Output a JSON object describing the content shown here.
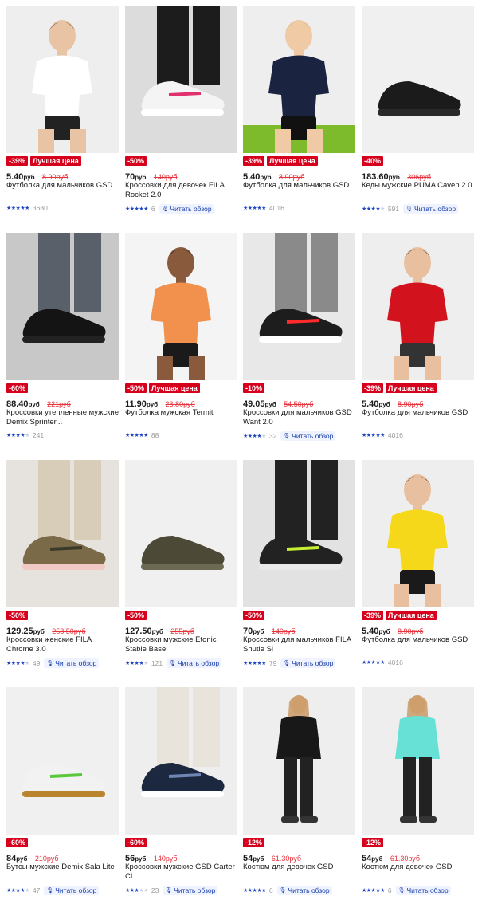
{
  "colors": {
    "discount_badge": "#d6001c",
    "old_price": "#e8323c",
    "stars": "#1f47c2",
    "review_link": "#1a3ea8"
  },
  "products": [
    {
      "discount": "-39%",
      "tag": "Лучшая цена",
      "price": "5.40",
      "currency": "руб",
      "old_price": "8.90руб",
      "name": "Футболка для мальчиков GSD",
      "rating": 5,
      "reviews": "3680",
      "review_link": ""
    },
    {
      "discount": "-50%",
      "tag": "",
      "price": "70",
      "currency": "руб",
      "old_price": "140руб",
      "name": "Кроссовки для девочек FILA Rocket 2.0",
      "rating": 5,
      "reviews": "6",
      "review_link": "Читать обзор"
    },
    {
      "discount": "-39%",
      "tag": "Лучшая цена",
      "price": "5.40",
      "currency": "руб",
      "old_price": "8.90руб",
      "name": "Футболка для мальчиков GSD",
      "rating": 5,
      "reviews": "4016",
      "review_link": ""
    },
    {
      "discount": "-40%",
      "tag": "",
      "price": "183.60",
      "currency": "руб",
      "old_price": "306руб",
      "name": "Кеды мужские PUMA Caven 2.0",
      "rating": 4,
      "reviews": "591",
      "review_link": "Читать обзор"
    },
    {
      "discount": "-60%",
      "tag": "",
      "price": "88.40",
      "currency": "руб",
      "old_price": "221руб",
      "name": "Кроссовки утепленные мужские Demix Sprinter...",
      "rating": 4,
      "reviews": "241",
      "review_link": ""
    },
    {
      "discount": "-50%",
      "tag": "Лучшая цена",
      "price": "11.90",
      "currency": "руб",
      "old_price": "23.80руб",
      "name": "Футболка мужская Termit",
      "rating": 5,
      "reviews": "88",
      "review_link": ""
    },
    {
      "discount": "-10%",
      "tag": "",
      "price": "49.05",
      "currency": "руб",
      "old_price": "54.50руб",
      "name": "Кроссовки для мальчиков GSD Want 2.0",
      "rating": 4,
      "reviews": "32",
      "review_link": "Читать обзор"
    },
    {
      "discount": "-39%",
      "tag": "Лучшая цена",
      "price": "5.40",
      "currency": "руб",
      "old_price": "8.90руб",
      "name": "Футболка для мальчиков GSD",
      "rating": 5,
      "reviews": "4016",
      "review_link": ""
    },
    {
      "discount": "-50%",
      "tag": "",
      "price": "129.25",
      "currency": "руб",
      "old_price": "258.50руб",
      "name": "Кроссовки женские FILA Chrome 3.0",
      "rating": 4,
      "reviews": "49",
      "review_link": "Читать обзор"
    },
    {
      "discount": "-50%",
      "tag": "",
      "price": "127.50",
      "currency": "руб",
      "old_price": "255руб",
      "name": "Кроссовки мужские Etonic Stable Base",
      "rating": 4,
      "reviews": "121",
      "review_link": "Читать обзор"
    },
    {
      "discount": "-50%",
      "tag": "",
      "price": "70",
      "currency": "руб",
      "old_price": "140руб",
      "name": "Кроссовки для мальчиков FILA Shutle Sl",
      "rating": 5,
      "reviews": "79",
      "review_link": "Читать обзор"
    },
    {
      "discount": "-39%",
      "tag": "Лучшая цена",
      "price": "5.40",
      "currency": "руб",
      "old_price": "8.90руб",
      "name": "Футболка для мальчиков GSD",
      "rating": 5,
      "reviews": "4016",
      "review_link": ""
    },
    {
      "discount": "-60%",
      "tag": "",
      "price": "84",
      "currency": "руб",
      "old_price": "210руб",
      "name": "Бутсы мужские Demix Sala Lite",
      "rating": 4,
      "reviews": "47",
      "review_link": "Читать обзор"
    },
    {
      "discount": "-60%",
      "tag": "",
      "price": "56",
      "currency": "руб",
      "old_price": "140руб",
      "name": "Кроссовки мужские GSD Carter CL",
      "rating": 3,
      "reviews": "23",
      "review_link": "Читать обзор"
    },
    {
      "discount": "-12%",
      "tag": "",
      "price": "54",
      "currency": "руб",
      "old_price": "61.30руб",
      "name": "Костюм для девочек GSD",
      "rating": 5,
      "reviews": "6",
      "review_link": "Читать обзор"
    },
    {
      "discount": "-12%",
      "tag": "",
      "price": "54",
      "currency": "руб",
      "old_price": "61.30руб",
      "name": "Костюм для девочек GSD",
      "rating": 5,
      "reviews": "6",
      "review_link": "Читать обзор"
    }
  ]
}
